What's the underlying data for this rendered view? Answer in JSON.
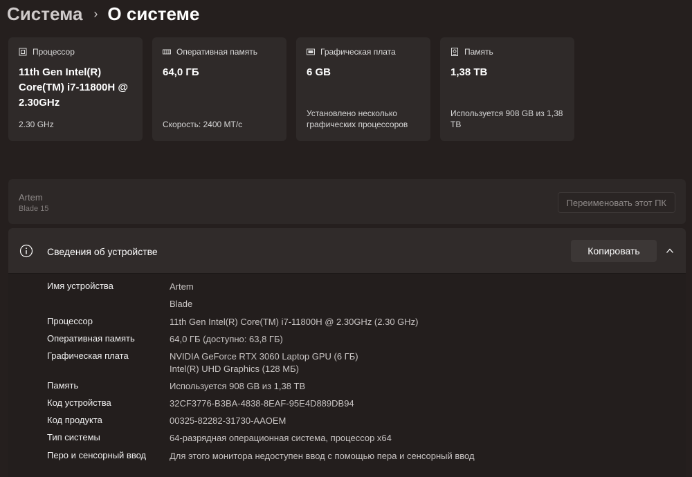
{
  "breadcrumb": {
    "parent": "Система",
    "separator": "›",
    "current": "О системе"
  },
  "cards": [
    {
      "label": "Процессор",
      "icon": "cpu-icon",
      "value": "11th Gen Intel(R) Core(TM) i7-11800H @ 2.30GHz",
      "sub": "2.30 GHz"
    },
    {
      "label": "Оперативная память",
      "icon": "ram-icon",
      "value": "64,0 ГБ",
      "sub": "Скорость: 2400 МТ/с"
    },
    {
      "label": "Графическая плата",
      "icon": "gpu-icon",
      "value": "6 GB",
      "sub": "Установлено несколько графических процессоров"
    },
    {
      "label": "Память",
      "icon": "storage-icon",
      "value": "1,38 TB",
      "sub": "Используется 908 GB из 1,38 TB"
    }
  ],
  "device": {
    "name": "Artem",
    "model": "Blade 15",
    "rename_label": "Переименовать этот ПК"
  },
  "specs": {
    "title": "Сведения об устройстве",
    "copy_label": "Копировать",
    "rows": [
      {
        "key": "Имя устройства",
        "value": "Artem"
      },
      {
        "key": "",
        "value": "Blade"
      },
      {
        "key": "Процессор",
        "value": "11th Gen Intel(R) Core(TM) i7-11800H @ 2.30GHz (2.30 GHz)"
      },
      {
        "key": "Оперативная память",
        "value": "64,0 ГБ (доступно: 63,8 ГБ)"
      },
      {
        "key": "Графическая плата",
        "value": "NVIDIA GeForce RTX 3060 Laptop GPU (6 ГБ)",
        "value2": "Intel(R) UHD Graphics (128 МБ)"
      },
      {
        "key": "Память",
        "value": "Используется 908 GB из 1,38 TB"
      },
      {
        "key": "Код устройства",
        "value": "32CF3776-B3BA-4838-8EAF-95E4D889DB94"
      },
      {
        "key": "Код продукта",
        "value": "00325-82282-31730-AAOEM"
      },
      {
        "key": "Тип системы",
        "value": "64-разрядная операционная система, процессор x64"
      },
      {
        "key": "Перо и сенсорный ввод",
        "value": "Для этого монитора недоступен ввод с помощью пера и сенсорный ввод"
      }
    ]
  }
}
